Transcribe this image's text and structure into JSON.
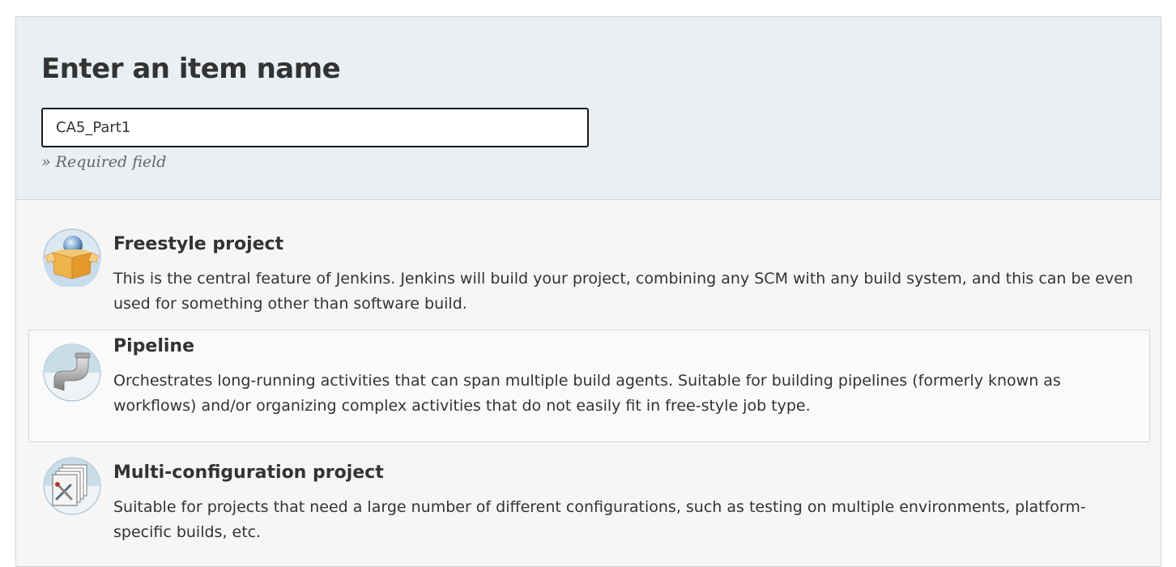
{
  "header": {
    "title": "Enter an item name",
    "name_input": {
      "value": "CA5_Part1",
      "placeholder": ""
    },
    "required_hint": "» Required field"
  },
  "item_types": [
    {
      "name": "Freestyle project",
      "description": "This is the central feature of Jenkins. Jenkins will build your project, combining any SCM with any build system, and this can be even used for something other than software build.",
      "icon": "freestyle-project-icon",
      "selected": false
    },
    {
      "name": "Pipeline",
      "description": "Orchestrates long-running activities that can span multiple build agents. Suitable for building pipelines (formerly known as workflows) and/or organizing complex activities that do not easily fit in free-style job type.",
      "icon": "pipeline-icon",
      "selected": true
    },
    {
      "name": "Multi-configuration project",
      "description": "Suitable for projects that need a large number of different configurations, such as testing on multiple environments, platform-specific builds, etc.",
      "icon": "multi-configuration-project-icon",
      "selected": false
    }
  ],
  "colors": {
    "header_bg": "#e9eff2",
    "list_bg": "#f6f6f6",
    "selected_bg": "#fafafa",
    "text": "#333333",
    "hint": "#666666"
  }
}
